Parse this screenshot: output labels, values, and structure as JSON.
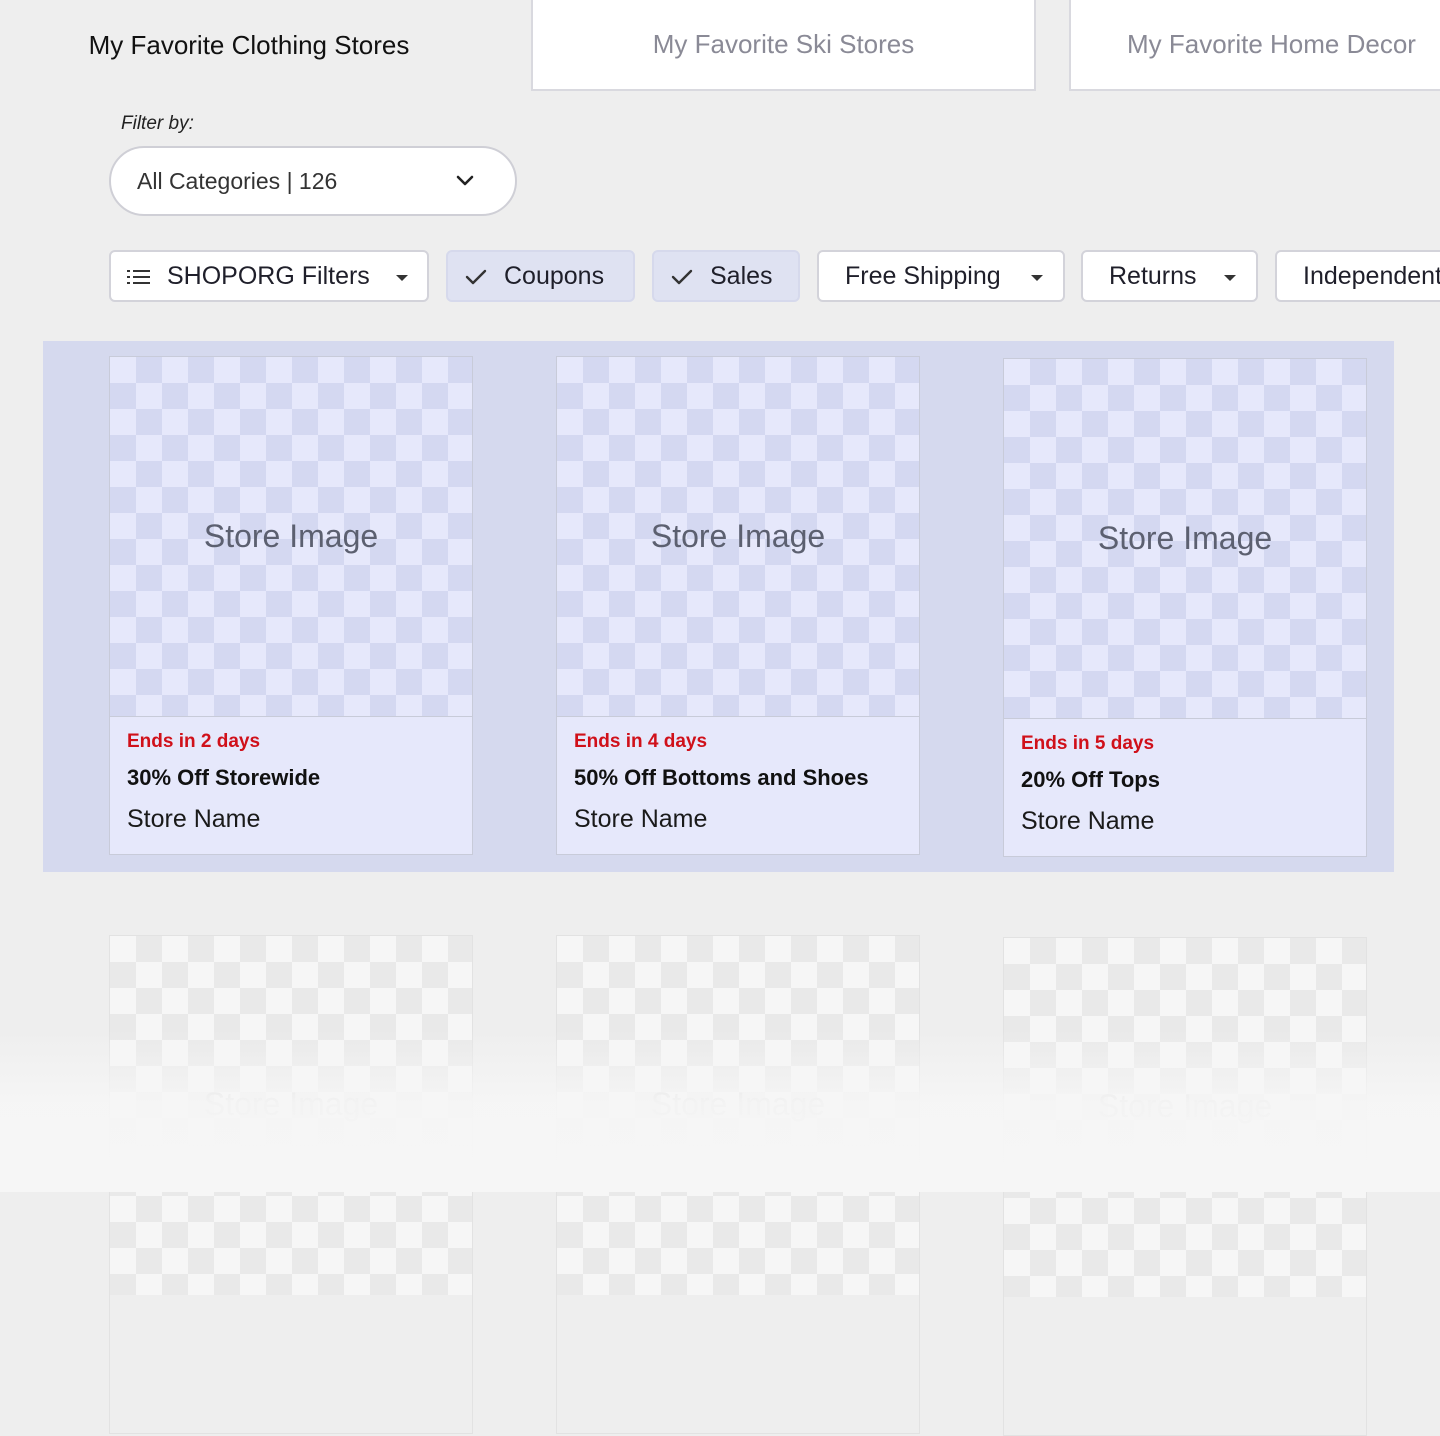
{
  "tabs": [
    {
      "label": "My Favorite Clothing Stores"
    },
    {
      "label": "My Favorite Ski Stores"
    },
    {
      "label": "My Favorite Home Decor"
    }
  ],
  "filter": {
    "label": "Filter by:",
    "selected": "All Categories | 126"
  },
  "chips": {
    "shoporg": "SHOPORG Filters",
    "coupons": "Coupons",
    "sales": "Sales",
    "free_shipping": "Free Shipping",
    "returns": "Returns",
    "independent": "Independent"
  },
  "cards": [
    {
      "image": "Store Image",
      "ends": "Ends in 2 days",
      "deal": "30% Off Storewide",
      "store": "Store Name"
    },
    {
      "image": "Store Image",
      "ends": "Ends in 4 days",
      "deal": "50% Off Bottoms and Shoes",
      "store": "Store Name"
    },
    {
      "image": "Store Image",
      "ends": "Ends in 5 days",
      "deal": "20% Off Tops",
      "store": "Store Name"
    }
  ],
  "faded_cards": [
    {
      "image": "Store Image"
    },
    {
      "image": "Store Image"
    },
    {
      "image": "Store Image"
    }
  ],
  "colors": {
    "accent_bg": "#d5d9ee",
    "card_bg": "#e6e8fb",
    "urgent_text": "#d0101a"
  },
  "icons": [
    "list-icon",
    "check-icon",
    "caret-down-icon",
    "chevron-down-icon"
  ]
}
